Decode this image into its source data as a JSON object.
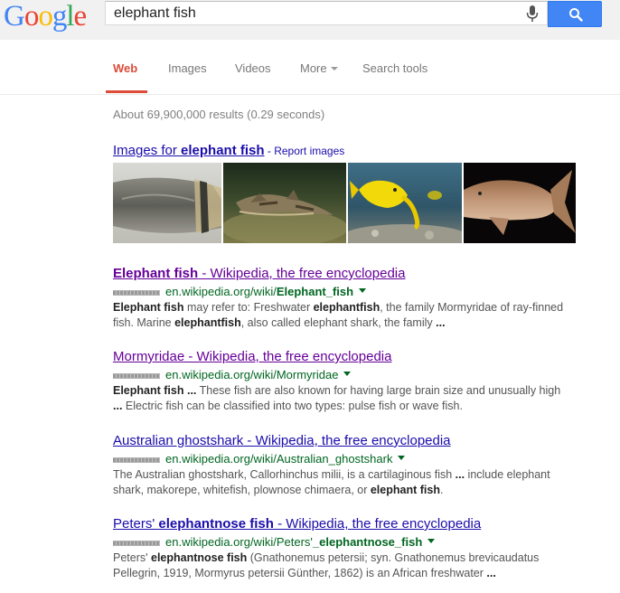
{
  "logo": {
    "text": "Google",
    "letters": [
      "G",
      "o",
      "o",
      "g",
      "l",
      "e"
    ]
  },
  "search": {
    "query": "elephant fish",
    "placeholder": ""
  },
  "nav": {
    "web": "Web",
    "images": "Images",
    "videos": "Videos",
    "more": "More",
    "search_tools": "Search tools"
  },
  "stats": "About 69,900,000 results (0.29 seconds)",
  "images_block": {
    "prefix": "Images for ",
    "query": "elephant fish",
    "separator": " - ",
    "report": "Report images"
  },
  "results": [
    {
      "title_parts": [
        {
          "text": "Elephant fish",
          "bold": true
        },
        {
          "text": " - Wikipedia, the free encyclopedia",
          "bold": false
        }
      ],
      "url_parts": [
        {
          "text": "en.wikipedia.org/wiki/",
          "bold": false
        },
        {
          "text": "Elephant_fish",
          "bold": true
        }
      ],
      "snippet_parts": [
        {
          "text": "Elephant fish",
          "bold": true
        },
        {
          "text": " may refer to: Freshwater ",
          "bold": false
        },
        {
          "text": "elephantfish",
          "bold": true
        },
        {
          "text": ", the family Mormyridae of ray-finned fish. Marine ",
          "bold": false
        },
        {
          "text": "elephantfish",
          "bold": true
        },
        {
          "text": ", also called elephant shark, the family ",
          "bold": false
        },
        {
          "text": "...",
          "bold": true
        }
      ]
    },
    {
      "title_parts": [
        {
          "text": "Mormyridae - Wikipedia, the free encyclopedia",
          "bold": false
        }
      ],
      "url_parts": [
        {
          "text": "en.wikipedia.org/wiki/Mormyridae",
          "bold": false
        }
      ],
      "snippet_parts": [
        {
          "text": "Elephant fish",
          "bold": true
        },
        {
          "text": " ",
          "bold": false
        },
        {
          "text": "...",
          "bold": true
        },
        {
          "text": " These fish are also known for having large brain size and unusually high ",
          "bold": false
        },
        {
          "text": "...",
          "bold": true
        },
        {
          "text": " Electric fish can be classified into two types: pulse fish or wave fish.",
          "bold": false
        }
      ]
    },
    {
      "title_parts": [
        {
          "text": "Australian ghostshark - Wikipedia, the free encyclopedia",
          "bold": false
        }
      ],
      "url_parts": [
        {
          "text": "en.wikipedia.org/wiki/Australian_ghostshark",
          "bold": false
        }
      ],
      "snippet_parts": [
        {
          "text": "The Australian ghostshark, Callorhinchus milii, is a cartilaginous fish ",
          "bold": false
        },
        {
          "text": "...",
          "bold": true
        },
        {
          "text": " include elephant shark, makorepe, whitefish, plownose chimaera, or ",
          "bold": false
        },
        {
          "text": "elephant fish",
          "bold": true
        },
        {
          "text": ".",
          "bold": false
        }
      ]
    },
    {
      "title_parts": [
        {
          "text": "Peters' ",
          "bold": false
        },
        {
          "text": "elephantnose fish",
          "bold": true
        },
        {
          "text": " - Wikipedia, the free encyclopedia",
          "bold": false
        }
      ],
      "url_parts": [
        {
          "text": "en.wikipedia.org/wiki/Peters'",
          "bold": false
        },
        {
          "text": "_elephantnose_fish",
          "bold": true
        }
      ],
      "snippet_parts": [
        {
          "text": "Peters' ",
          "bold": false
        },
        {
          "text": "elephantnose fish",
          "bold": true
        },
        {
          "text": " (Gnathonemus petersii; syn. Gnathonemus brevicaudatus Pellegrin, 1919, Mormyrus petersii Günther, 1862) is an African freshwater ",
          "bold": false
        },
        {
          "text": "...",
          "bold": true
        }
      ]
    }
  ],
  "colors": {
    "link": "#1a0dab",
    "visited": "#660099",
    "url": "#006621",
    "active_tab": "#dd4b39",
    "search_button": "#4285f4"
  }
}
